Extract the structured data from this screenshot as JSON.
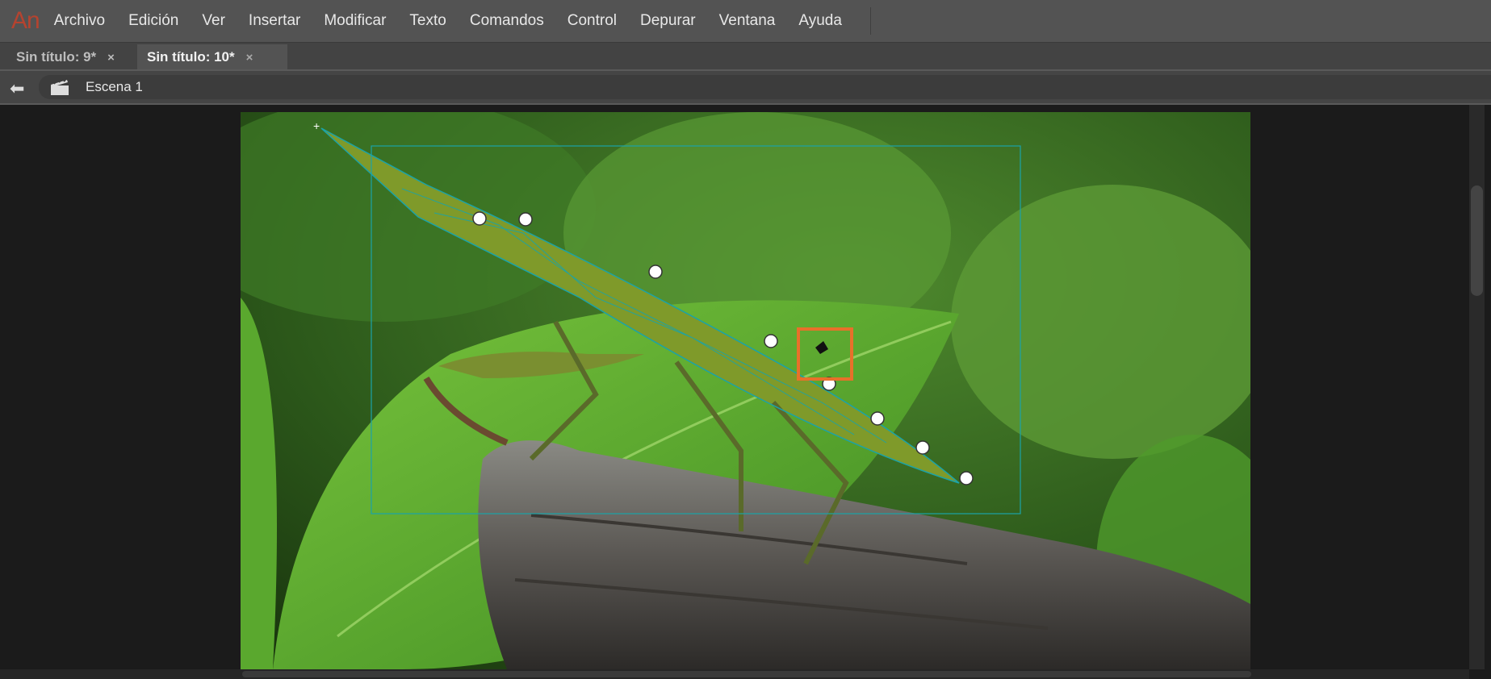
{
  "app": {
    "logo": "An"
  },
  "menu": [
    "Archivo",
    "Edición",
    "Ver",
    "Insertar",
    "Modificar",
    "Texto",
    "Comandos",
    "Control",
    "Depurar",
    "Ventana",
    "Ayuda"
  ],
  "tabs": [
    {
      "label": "Sin título: 9*",
      "close": "×"
    },
    {
      "label": "Sin título: 10*",
      "close": "×",
      "active": true
    }
  ],
  "breadcrumb": {
    "back_icon": "arrow-left-icon",
    "scene_icon": "clapperboard-icon",
    "scene": "Escena 1"
  },
  "colors": {
    "accent": "#b5432f",
    "mesh": "#1aa3a8",
    "selection": "#e8702a"
  }
}
